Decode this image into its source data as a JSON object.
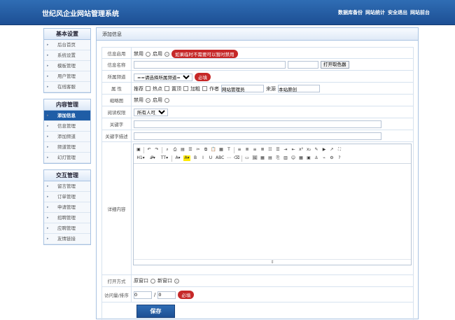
{
  "header": {
    "title": "世纪风企业网站管理系统",
    "links": [
      "数据库备份",
      "网站统计",
      "安全退出",
      "网站前台"
    ]
  },
  "sidebar": {
    "groups": [
      {
        "title": "基本设置",
        "items": [
          "后台首页",
          "系统设置",
          "模板管理",
          "用户管理",
          "在线客服"
        ]
      },
      {
        "title": "内容管理",
        "items": [
          "添加信息",
          "信息管理",
          "添加频道",
          "频道管理",
          "幻灯管理"
        ]
      },
      {
        "title": "交互管理",
        "items": [
          "留言管理",
          "订单管理",
          "申请管理",
          "招聘管理",
          "应聘管理",
          "友情链接"
        ]
      }
    ]
  },
  "main": {
    "title": "添加信息"
  },
  "form": {
    "status_label": "信息启用",
    "disable": "禁用",
    "enable": "启用",
    "status_hint": "如果临时不需要可以暂时禁用",
    "name_label": "信息名称",
    "color_button": "打开取色器",
    "channel_label": "所属频道",
    "channel_option": "==请选择所属频道==",
    "required": "必填",
    "attr_label": "属 性",
    "recommend": "推荐",
    "hot": "热点",
    "top": "置顶",
    "bold": "加粗",
    "author_label": "作者",
    "author_value": "网站管理员",
    "source_label": "来源",
    "source_value": "本站原创",
    "thumb_label": "缩略图",
    "thumb_disable": "禁用",
    "thumb_enable": "启用",
    "permission_label": "阅读权限",
    "permission_option": "所有人可见",
    "keywords_label": "关键字",
    "desc_label": "关键字描述",
    "content_label": "详细内容",
    "open_label": "打开方式",
    "open_old": "原窗口",
    "open_new": "新窗口",
    "visits_label": "访问量/排序",
    "visits_value": "0",
    "sort_sep": "/",
    "sort_value": "0",
    "save": "保存"
  },
  "toolbar": {
    "row1": [
      "▣",
      "↶",
      "↷",
      "⌕",
      "⎙",
      "▤",
      "☰",
      "✂",
      "⧉",
      "📋",
      "▦",
      "T",
      "≡",
      "≣",
      "≡",
      "≣",
      "☷",
      "☰",
      "⇥",
      "⇤",
      "x²",
      "x₂",
      "✎",
      "▶",
      "↗",
      "⛶"
    ],
    "row2": [
      "H1▾",
      "𝓕▾",
      "TT▾",
      "A▾",
      "A▾",
      "B",
      "I",
      "U",
      "ABC",
      "⋯",
      "⌫",
      "▭",
      "🖼",
      "▦",
      "▤",
      "⎘",
      "▥",
      "☺",
      "▦",
      "▣",
      "⚓",
      "⌁",
      "⚙",
      "?"
    ],
    "resize": "⇕"
  }
}
